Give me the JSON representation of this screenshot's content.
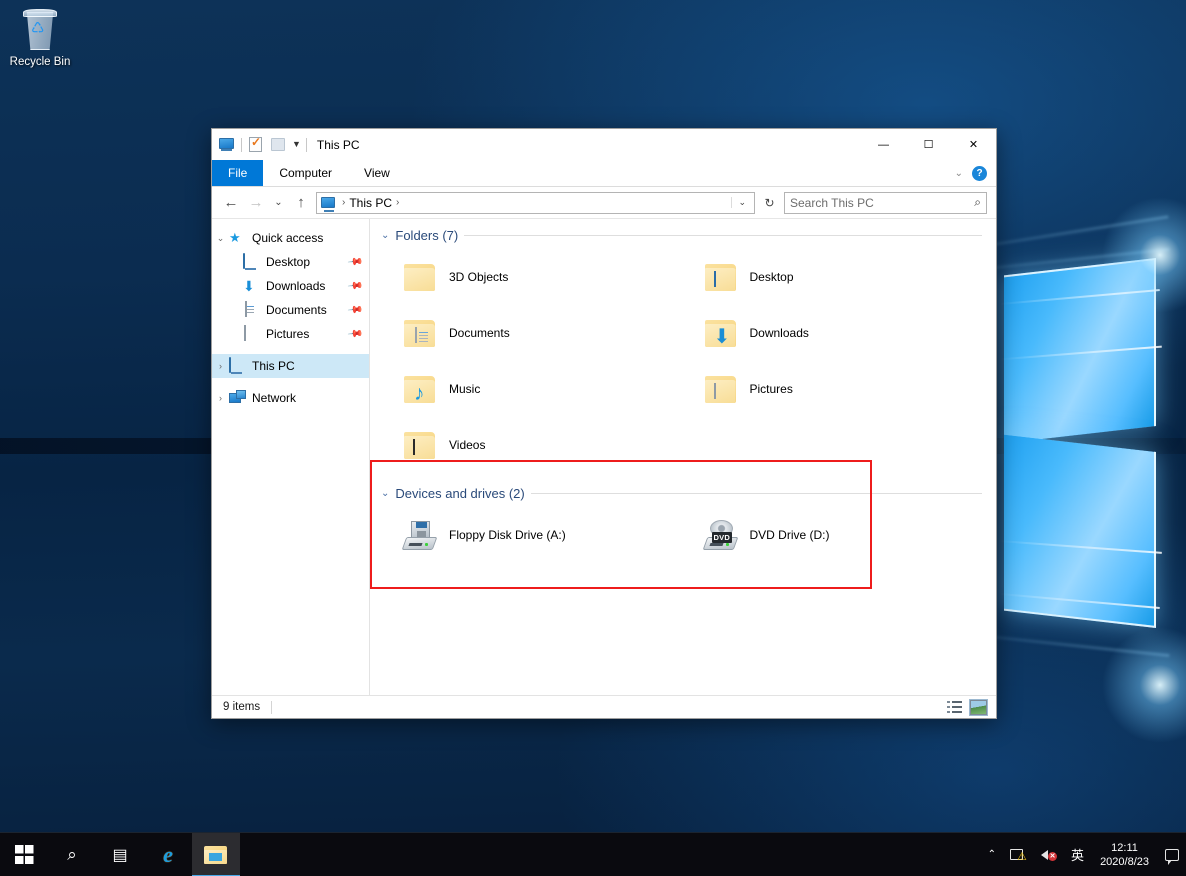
{
  "desktop": {
    "icons": [
      {
        "label": "Recycle Bin",
        "icon": "recycle-bin-icon"
      }
    ]
  },
  "window": {
    "title": "This PC",
    "quick_access_toolbar": [
      {
        "icon": "this-pc-icon",
        "name": "system-menu"
      },
      {
        "icon": "properties-icon",
        "name": "properties"
      },
      {
        "icon": "new-folder-icon",
        "name": "new-folder"
      },
      {
        "icon": "chevron-down-icon",
        "name": "customize-qat"
      }
    ],
    "controls": {
      "minimize": "—",
      "maximize": "☐",
      "close": "✕"
    },
    "ribbon": {
      "tabs": [
        {
          "label": "File",
          "active": true
        },
        {
          "label": "Computer",
          "active": false
        },
        {
          "label": "View",
          "active": false
        }
      ],
      "expand_icon": "chevron-down-icon",
      "help_label": "?"
    },
    "address": {
      "back_icon": "←",
      "forward_icon": "→",
      "recent_icon": "⌄",
      "up_icon": "↑",
      "crumb_icon": "this-pc-icon",
      "crumb": "This PC",
      "crumb_separator": "›",
      "dropdown_icon": "⌄",
      "refresh_icon": "↻"
    },
    "search": {
      "placeholder": "Search This PC",
      "icon": "search-icon"
    },
    "status": {
      "item_count": "9 items",
      "views": [
        {
          "name": "details-view",
          "selected": false
        },
        {
          "name": "large-icons-view",
          "selected": true
        }
      ]
    }
  },
  "sidebar": {
    "items": [
      {
        "label": "Quick access",
        "icon": "star-icon",
        "chevron": "⌄",
        "level": 0,
        "selected": false,
        "pinned": false
      },
      {
        "label": "Desktop",
        "icon": "desktop-icon",
        "chevron": "",
        "level": 1,
        "selected": false,
        "pinned": true
      },
      {
        "label": "Downloads",
        "icon": "download-icon",
        "chevron": "",
        "level": 1,
        "selected": false,
        "pinned": true
      },
      {
        "label": "Documents",
        "icon": "document-icon",
        "chevron": "",
        "level": 1,
        "selected": false,
        "pinned": true
      },
      {
        "label": "Pictures",
        "icon": "picture-icon",
        "chevron": "",
        "level": 1,
        "selected": false,
        "pinned": true
      },
      {
        "label": "This PC",
        "icon": "this-pc-icon",
        "chevron": "›",
        "level": 0,
        "selected": true,
        "pinned": false
      },
      {
        "label": "Network",
        "icon": "network-icon",
        "chevron": "›",
        "level": 0,
        "selected": false,
        "pinned": false
      }
    ],
    "pin_icon": "📌"
  },
  "content": {
    "groups": [
      {
        "title": "Folders (7)",
        "chevron": "⌄",
        "items": [
          {
            "label": "3D Objects",
            "icon": "folder-3d-objects-icon",
            "badge": "cube"
          },
          {
            "label": "Desktop",
            "icon": "folder-desktop-icon",
            "badge": "monitor"
          },
          {
            "label": "Documents",
            "icon": "folder-documents-icon",
            "badge": "document"
          },
          {
            "label": "Downloads",
            "icon": "folder-downloads-icon",
            "badge": "arrow"
          },
          {
            "label": "Music",
            "icon": "folder-music-icon",
            "badge": "note"
          },
          {
            "label": "Pictures",
            "icon": "folder-pictures-icon",
            "badge": "image"
          },
          {
            "label": "Videos",
            "icon": "folder-videos-icon",
            "badge": "film"
          }
        ]
      },
      {
        "title": "Devices and drives (2)",
        "chevron": "⌄",
        "highlighted": true,
        "items": [
          {
            "label": "Floppy Disk Drive (A:)",
            "icon": "floppy-drive-icon",
            "badge": "floppy"
          },
          {
            "label": "DVD Drive (D:)",
            "icon": "dvd-drive-icon",
            "badge": "dvd",
            "tag": "DVD"
          }
        ]
      }
    ]
  },
  "taskbar": {
    "buttons": [
      {
        "name": "start-button",
        "icon": "windows-logo-icon"
      },
      {
        "name": "search-button",
        "icon": "search-icon"
      },
      {
        "name": "task-view-button",
        "icon": "task-view-icon"
      },
      {
        "name": "internet-explorer-button",
        "icon": "internet-explorer-icon",
        "glyph": "e"
      },
      {
        "name": "file-explorer-button",
        "icon": "file-explorer-icon",
        "active": true
      }
    ],
    "tray": {
      "chevron": "⌃",
      "network_icon": "network-warning-icon",
      "volume_icon": "volume-muted-icon",
      "volume_badge": "✕",
      "ime": "英",
      "time": "12:11",
      "date": "2020/8/23",
      "notification_icon": "action-center-icon"
    }
  },
  "colors": {
    "accent": "#0078d7",
    "selection": "#cde8f7",
    "highlight_box": "#ee1c1c",
    "group_title": "#2a4a7a",
    "taskbar": "#0a0a0f"
  }
}
